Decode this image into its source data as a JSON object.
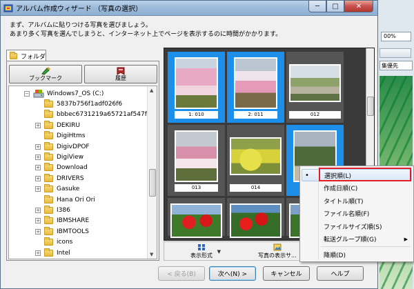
{
  "window": {
    "title": "アルバム作成ウィザード （写真の選択）",
    "buttons": {
      "minimize": "─",
      "maximize": "□",
      "close": "✕"
    }
  },
  "instructions": {
    "line1": "まず、アルバムに貼りつける写真を選びましょう。",
    "line2": "あまり多く写真を選んでしまうと、インターネット上でページを表示するのに時間がかかります。"
  },
  "folder_panel": {
    "tab_label": "フォルダ",
    "bookmark_label": "ブックマーク",
    "history_label": "履歴",
    "tree": [
      {
        "label": "Windows7_OS (C:)",
        "level": 0,
        "type": "drive",
        "expander": "−"
      },
      {
        "label": "5837b756f1adf026f6",
        "level": 1,
        "type": "folder",
        "expander": ""
      },
      {
        "label": "bbbec6731219a65721af547f",
        "level": 1,
        "type": "folder",
        "expander": ""
      },
      {
        "label": "DEKIRU",
        "level": 1,
        "type": "folder",
        "expander": "+"
      },
      {
        "label": "DigiHtms",
        "level": 1,
        "type": "folder",
        "expander": ""
      },
      {
        "label": "DigivDPOF",
        "level": 1,
        "type": "folder",
        "expander": "+"
      },
      {
        "label": "DigiView",
        "level": 1,
        "type": "folder",
        "expander": "+"
      },
      {
        "label": "Download",
        "level": 1,
        "type": "folder",
        "expander": "+"
      },
      {
        "label": "DRIVERS",
        "level": 1,
        "type": "folder",
        "expander": "+"
      },
      {
        "label": "Gasuke",
        "level": 1,
        "type": "folder",
        "expander": "+"
      },
      {
        "label": "Hana Ori Ori",
        "level": 1,
        "type": "folder",
        "expander": ""
      },
      {
        "label": "I386",
        "level": 1,
        "type": "folder",
        "expander": "+"
      },
      {
        "label": "IBMSHARE",
        "level": 1,
        "type": "folder",
        "expander": "+"
      },
      {
        "label": "IBMTOOLS",
        "level": 1,
        "type": "folder",
        "expander": "+"
      },
      {
        "label": "icons",
        "level": 1,
        "type": "folder",
        "expander": ""
      },
      {
        "label": "Intel",
        "level": 1,
        "type": "folder",
        "expander": "+"
      }
    ]
  },
  "photos": [
    {
      "caption": "1: 010",
      "selected": true,
      "kind": "plum-tall"
    },
    {
      "caption": "2: 011",
      "selected": true,
      "kind": "plum-tall2"
    },
    {
      "caption": "012",
      "selected": false,
      "kind": "garden-wide"
    },
    {
      "caption": "013",
      "selected": false,
      "kind": "plum-tall3"
    },
    {
      "caption": "014",
      "selected": false,
      "kind": "rape-wide"
    },
    {
      "caption": "",
      "selected": true,
      "kind": "tree-tall"
    },
    {
      "caption": "",
      "selected": false,
      "kind": "red-wide"
    },
    {
      "caption": "",
      "selected": false,
      "kind": "red-wide2"
    },
    {
      "caption": "",
      "selected": false,
      "kind": "red-wide3"
    }
  ],
  "tools": {
    "view_format": "表示形式",
    "photo_display": "写真の表示サ..."
  },
  "wizard_buttons": {
    "back": "< 戻る(B)",
    "next": "次へ(N) >",
    "cancel": "キャンセル",
    "help": "ヘルプ"
  },
  "context_menu": {
    "items": [
      {
        "label": "選択順(L)",
        "checked": true,
        "submenu": false
      },
      {
        "label": "作成日順(C)",
        "checked": false,
        "submenu": false
      },
      {
        "label": "タイトル順(T)",
        "checked": false,
        "submenu": false
      },
      {
        "label": "ファイル名順(F)",
        "checked": false,
        "submenu": false
      },
      {
        "label": "ファイルサイズ順(S)",
        "checked": false,
        "submenu": false
      },
      {
        "label": "転送グループ順(G)",
        "checked": false,
        "submenu": true
      }
    ],
    "descending": "降順(D)",
    "bullet": "•",
    "submenu_arrow": "▶"
  },
  "background_app": {
    "zoom": "00%",
    "dropdown": "集優先"
  },
  "colors": {
    "selection": "#1e8fe8",
    "highlight": "#e31b23"
  }
}
